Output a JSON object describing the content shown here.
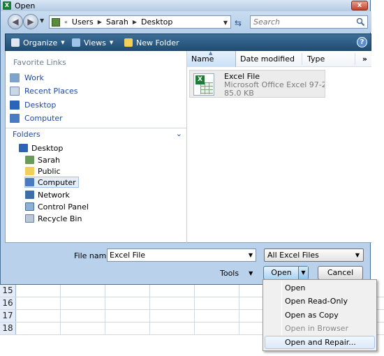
{
  "window": {
    "title": "Open",
    "close_glyph": "x"
  },
  "excel": {
    "row_numbers": [
      "15",
      "16",
      "17",
      "18"
    ]
  },
  "address": {
    "crumbs": [
      "Users",
      "Sarah",
      "Desktop"
    ],
    "search_placeholder": "Search"
  },
  "toolbar": {
    "organize_label": "Organize",
    "views_label": "Views",
    "new_folder_label": "New Folder",
    "help_glyph": "?"
  },
  "favorites": {
    "header": "Favorite Links",
    "items": [
      {
        "label": "Work",
        "icon": "document-icon"
      },
      {
        "label": "Recent Places",
        "icon": "recent-places-icon"
      },
      {
        "label": "Desktop",
        "icon": "desktop-icon"
      },
      {
        "label": "Computer",
        "icon": "computer-icon"
      }
    ]
  },
  "folders": {
    "header": "Folders",
    "tree": [
      {
        "label": "Desktop",
        "icon": "desktop-icon",
        "level": 0
      },
      {
        "label": "Sarah",
        "icon": "user-folder-icon",
        "level": 1
      },
      {
        "label": "Public",
        "icon": "folder-icon",
        "level": 1
      },
      {
        "label": "Computer",
        "icon": "computer-icon",
        "level": 1,
        "selected": true
      },
      {
        "label": "Network",
        "icon": "network-icon",
        "level": 1
      },
      {
        "label": "Control Panel",
        "icon": "control-panel-icon",
        "level": 1
      },
      {
        "label": "Recycle Bin",
        "icon": "recycle-bin-icon",
        "level": 1
      }
    ]
  },
  "columns": {
    "name": "Name",
    "date_modified": "Date modified",
    "type": "Type",
    "more": "»"
  },
  "file": {
    "name": "Excel File",
    "type": "Microsoft Office Excel 97-20...",
    "size": "85.0 KB",
    "icon": "excel-file-icon"
  },
  "bottom": {
    "filename_label": "File name:",
    "filename_value": "Excel File",
    "filetype_value": "All Excel Files",
    "tools_label": "Tools",
    "open_label": "Open",
    "cancel_label": "Cancel"
  },
  "open_menu": {
    "items": [
      {
        "label": "Open",
        "disabled": false
      },
      {
        "label": "Open Read-Only",
        "disabled": false
      },
      {
        "label": "Open as Copy",
        "disabled": false
      },
      {
        "label": "Open in Browser",
        "disabled": true
      },
      {
        "label": "Open and Repair...",
        "disabled": false,
        "hover": true
      }
    ]
  },
  "colors": {
    "dialog_bg": "#b9d1ea",
    "toolbar_bg": "#2b5a82",
    "link": "#1e4aa0",
    "excel_green": "#1d7a38"
  }
}
